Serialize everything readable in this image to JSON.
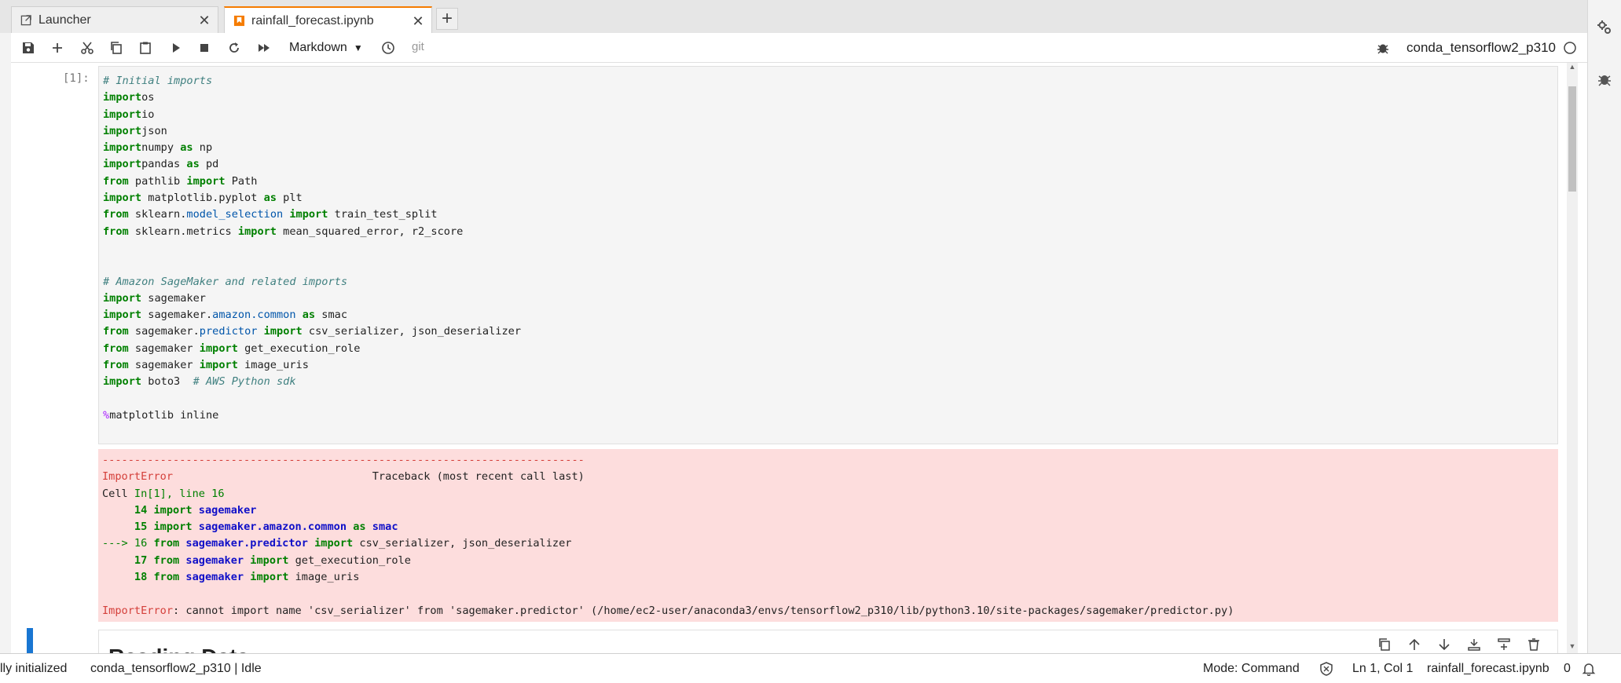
{
  "tabs": [
    {
      "label": "Launcher",
      "icon": "launcher-icon",
      "active": false
    },
    {
      "label": "rainfall_forecast.ipynb",
      "icon": "notebook-icon",
      "active": true
    }
  ],
  "toolbar": {
    "cell_type": "Markdown",
    "git_label": "git",
    "kernel": "conda_tensorflow2_p310"
  },
  "cell": {
    "prompt": "[1]:",
    "code": [
      [
        [
          "cm",
          "# Initial imports"
        ]
      ],
      [
        [
          "kw",
          "import"
        ],
        [
          "",
          "os"
        ]
      ],
      [
        [
          "kw",
          "import"
        ],
        [
          "",
          "io"
        ]
      ],
      [
        [
          "kw",
          "import"
        ],
        [
          "",
          "json"
        ]
      ],
      [
        [
          "kw",
          "import"
        ],
        [
          "",
          "numpy "
        ],
        [
          "kw",
          "as"
        ],
        [
          "",
          " np"
        ]
      ],
      [
        [
          "kw",
          "import"
        ],
        [
          "",
          "pandas "
        ],
        [
          "kw",
          "as"
        ],
        [
          "",
          " pd"
        ]
      ],
      [
        [
          "kw",
          "from"
        ],
        [
          "",
          " pathlib "
        ],
        [
          "kw",
          "import"
        ],
        [
          "",
          " Path"
        ]
      ],
      [
        [
          "kw",
          "import"
        ],
        [
          "",
          " matplotlib.pyplot "
        ],
        [
          "kw",
          "as"
        ],
        [
          "",
          " plt"
        ]
      ],
      [
        [
          "kw",
          "from"
        ],
        [
          "",
          " sklearn."
        ],
        [
          "mod",
          "model_selection"
        ],
        [
          "",
          " "
        ],
        [
          "kw",
          "import"
        ],
        [
          "",
          " train_test_split"
        ]
      ],
      [
        [
          "kw",
          "from"
        ],
        [
          "",
          " sklearn.metrics "
        ],
        [
          "kw",
          "import"
        ],
        [
          "",
          " mean_squared_error, r2_score"
        ]
      ],
      [],
      [],
      [
        [
          "cm",
          "# Amazon SageMaker and related imports"
        ]
      ],
      [
        [
          "kw",
          "import"
        ],
        [
          "",
          " sagemaker"
        ]
      ],
      [
        [
          "kw",
          "import"
        ],
        [
          "",
          " sagemaker."
        ],
        [
          "mod",
          "amazon.common"
        ],
        [
          "",
          " "
        ],
        [
          "kw",
          "as"
        ],
        [
          "",
          " smac"
        ]
      ],
      [
        [
          "kw",
          "from"
        ],
        [
          "",
          " sagemaker."
        ],
        [
          "mod",
          "predictor"
        ],
        [
          "",
          " "
        ],
        [
          "kw",
          "import"
        ],
        [
          "",
          " csv_serializer, json_deserializer"
        ]
      ],
      [
        [
          "kw",
          "from"
        ],
        [
          "",
          " sagemaker "
        ],
        [
          "kw",
          "import"
        ],
        [
          "",
          " get_execution_role"
        ]
      ],
      [
        [
          "kw",
          "from"
        ],
        [
          "",
          " sagemaker "
        ],
        [
          "kw",
          "import"
        ],
        [
          "",
          " image_uris"
        ]
      ],
      [
        [
          "kw",
          "import"
        ],
        [
          "",
          " boto3  "
        ],
        [
          "cm",
          "# AWS Python sdk"
        ]
      ],
      [],
      [
        [
          "mg",
          "%"
        ],
        [
          "",
          "matplotlib inline"
        ]
      ]
    ]
  },
  "output": [
    [
      [
        "err",
        "---------------------------------------------------------------------------"
      ]
    ],
    [
      [
        "err",
        "ImportError"
      ],
      [
        "",
        "                               Traceback (most recent call last)"
      ]
    ],
    [
      [
        "",
        "Cell "
      ],
      [
        "grn",
        "In[1], line 16"
      ]
    ],
    [
      [
        "",
        "     "
      ],
      [
        "gb",
        "14"
      ],
      [
        "",
        " "
      ],
      [
        "gb",
        "import"
      ],
      [
        "",
        " "
      ],
      [
        "bb",
        "sagemaker"
      ]
    ],
    [
      [
        "",
        "     "
      ],
      [
        "gb",
        "15"
      ],
      [
        "",
        " "
      ],
      [
        "gb",
        "import"
      ],
      [
        "",
        " "
      ],
      [
        "bb",
        "sagemaker.amazon.common"
      ],
      [
        "",
        " "
      ],
      [
        "gb",
        "as"
      ],
      [
        "",
        " "
      ],
      [
        "bb",
        "smac"
      ]
    ],
    [
      [
        "grn",
        "---> 16"
      ],
      [
        "",
        " "
      ],
      [
        "gb",
        "from"
      ],
      [
        "",
        " "
      ],
      [
        "bb",
        "sagemaker.predictor"
      ],
      [
        "",
        " "
      ],
      [
        "gb",
        "import"
      ],
      [
        "",
        " csv_serializer, json_deserializer"
      ]
    ],
    [
      [
        "",
        "     "
      ],
      [
        "gb",
        "17"
      ],
      [
        "",
        " "
      ],
      [
        "gb",
        "from"
      ],
      [
        "",
        " "
      ],
      [
        "bb",
        "sagemaker"
      ],
      [
        "",
        " "
      ],
      [
        "gb",
        "import"
      ],
      [
        "",
        " get_execution_role"
      ]
    ],
    [
      [
        "",
        "     "
      ],
      [
        "gb",
        "18"
      ],
      [
        "",
        " "
      ],
      [
        "gb",
        "from"
      ],
      [
        "",
        " "
      ],
      [
        "bb",
        "sagemaker"
      ],
      [
        "",
        " "
      ],
      [
        "gb",
        "import"
      ],
      [
        "",
        " image_uris"
      ]
    ],
    [],
    [
      [
        "err",
        "ImportError"
      ],
      [
        "",
        ": cannot import name 'csv_serializer' from 'sagemaker.predictor' (/home/ec2-user/anaconda3/envs/tensorflow2_p310/lib/python3.10/site-packages/sagemaker/predictor.py)"
      ]
    ]
  ],
  "next_cell": {
    "heading_peek": "Reading Data"
  },
  "status": {
    "init": "lly initialized",
    "kernel_state": "conda_tensorflow2_p310 | Idle",
    "mode": "Mode: Command",
    "position": "Ln 1, Col 1",
    "file": "rainfall_forecast.ipynb",
    "notifications": "0"
  },
  "colors": {
    "accent": "#f57c00",
    "error_bg": "#fddddd",
    "active_cell": "#1976d2"
  }
}
